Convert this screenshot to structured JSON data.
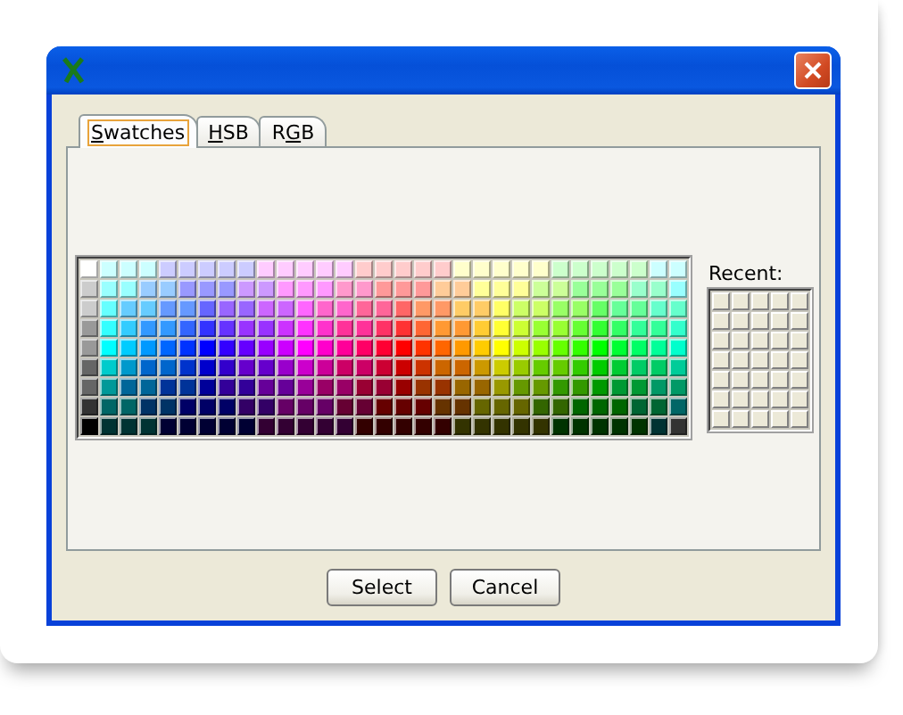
{
  "tabs": [
    {
      "mnemonic": "S",
      "label_after": "watches",
      "selected": true
    },
    {
      "mnemonic": "H",
      "label_after": "SB",
      "selected": false
    },
    {
      "label_before": "R",
      "mnemonic": "G",
      "label_after": "B",
      "selected": false
    }
  ],
  "swatches": [
    [
      {
        "color": "#ffffff"
      },
      {
        "color": "#ccffff"
      },
      {
        "color": "#ccffff"
      },
      {
        "color": "#ccffff"
      },
      {
        "color": "#ccccff"
      },
      {
        "color": "#ccccff"
      },
      {
        "color": "#ccccff"
      },
      {
        "color": "#ccccff"
      },
      {
        "color": "#ccccff"
      },
      {
        "color": "#ffccff"
      },
      {
        "color": "#ffccff"
      },
      {
        "color": "#ffccff"
      },
      {
        "color": "#ffccff"
      },
      {
        "color": "#ffccff"
      },
      {
        "color": "#ffcccc"
      },
      {
        "color": "#ffcccc"
      },
      {
        "color": "#ffcccc"
      },
      {
        "color": "#ffcccc"
      },
      {
        "color": "#ffcccc"
      },
      {
        "color": "#ffffcc"
      },
      {
        "color": "#ffffcc"
      },
      {
        "color": "#ffffcc"
      },
      {
        "color": "#ffffcc"
      },
      {
        "color": "#ffffcc"
      },
      {
        "color": "#ccffcc"
      },
      {
        "color": "#ccffcc"
      },
      {
        "color": "#ccffcc"
      },
      {
        "color": "#ccffcc"
      },
      {
        "color": "#ccffcc"
      },
      {
        "color": "#ccffff"
      },
      {
        "color": "#ccffff"
      }
    ],
    [
      {
        "color": "#cccccc"
      },
      {
        "color": "#99ffff"
      },
      {
        "color": "#99ffff"
      },
      {
        "color": "#99ccff"
      },
      {
        "color": "#99ccff"
      },
      {
        "color": "#9999ff"
      },
      {
        "color": "#9999ff"
      },
      {
        "color": "#9999ff"
      },
      {
        "color": "#cc99ff"
      },
      {
        "color": "#cc99ff"
      },
      {
        "color": "#ff99ff"
      },
      {
        "color": "#ff99ff"
      },
      {
        "color": "#ff99ff"
      },
      {
        "color": "#ff99cc"
      },
      {
        "color": "#ff99cc"
      },
      {
        "color": "#ff9999"
      },
      {
        "color": "#ff9999"
      },
      {
        "color": "#ff9999"
      },
      {
        "color": "#ffcc99"
      },
      {
        "color": "#ffcc99"
      },
      {
        "color": "#ffff99"
      },
      {
        "color": "#ffff99"
      },
      {
        "color": "#ffff99"
      },
      {
        "color": "#ccff99"
      },
      {
        "color": "#ccff99"
      },
      {
        "color": "#99ff99"
      },
      {
        "color": "#99ff99"
      },
      {
        "color": "#99ff99"
      },
      {
        "color": "#99ffcc"
      },
      {
        "color": "#99ffcc"
      },
      {
        "color": "#99ffff"
      }
    ],
    [
      {
        "color": "#cccccc"
      },
      {
        "color": "#66ffff"
      },
      {
        "color": "#66ccff"
      },
      {
        "color": "#66ccff"
      },
      {
        "color": "#6699ff"
      },
      {
        "color": "#6699ff"
      },
      {
        "color": "#6666ff"
      },
      {
        "color": "#9966ff"
      },
      {
        "color": "#9966ff"
      },
      {
        "color": "#cc66ff"
      },
      {
        "color": "#cc66ff"
      },
      {
        "color": "#ff66ff"
      },
      {
        "color": "#ff66cc"
      },
      {
        "color": "#ff66cc"
      },
      {
        "color": "#ff6699"
      },
      {
        "color": "#ff6699"
      },
      {
        "color": "#ff6666"
      },
      {
        "color": "#ff9966"
      },
      {
        "color": "#ff9966"
      },
      {
        "color": "#ffcc66"
      },
      {
        "color": "#ffcc66"
      },
      {
        "color": "#ffff66"
      },
      {
        "color": "#ccff66"
      },
      {
        "color": "#ccff66"
      },
      {
        "color": "#99ff66"
      },
      {
        "color": "#99ff66"
      },
      {
        "color": "#66ff66"
      },
      {
        "color": "#66ff99"
      },
      {
        "color": "#66ff99"
      },
      {
        "color": "#66ffcc"
      },
      {
        "color": "#66ffcc"
      }
    ],
    [
      {
        "color": "#999999"
      },
      {
        "color": "#33ffff"
      },
      {
        "color": "#33ccff"
      },
      {
        "color": "#3399ff"
      },
      {
        "color": "#3399ff"
      },
      {
        "color": "#3366ff"
      },
      {
        "color": "#3333ff"
      },
      {
        "color": "#6633ff"
      },
      {
        "color": "#9933ff"
      },
      {
        "color": "#9933ff"
      },
      {
        "color": "#cc33ff"
      },
      {
        "color": "#ff33ff"
      },
      {
        "color": "#ff33cc"
      },
      {
        "color": "#ff3399"
      },
      {
        "color": "#ff3399"
      },
      {
        "color": "#ff3366"
      },
      {
        "color": "#ff3333"
      },
      {
        "color": "#ff6633"
      },
      {
        "color": "#ff9933"
      },
      {
        "color": "#ff9933"
      },
      {
        "color": "#ffcc33"
      },
      {
        "color": "#ffff33"
      },
      {
        "color": "#ccff33"
      },
      {
        "color": "#99ff33"
      },
      {
        "color": "#99ff33"
      },
      {
        "color": "#66ff33"
      },
      {
        "color": "#33ff33"
      },
      {
        "color": "#33ff66"
      },
      {
        "color": "#33ff99"
      },
      {
        "color": "#33ff99"
      },
      {
        "color": "#33ffcc"
      }
    ],
    [
      {
        "color": "#999999"
      },
      {
        "color": "#00ffff"
      },
      {
        "color": "#00ccff"
      },
      {
        "color": "#0099ff"
      },
      {
        "color": "#0066ff"
      },
      {
        "color": "#0033ff"
      },
      {
        "color": "#0000ff"
      },
      {
        "color": "#3300ff"
      },
      {
        "color": "#6600ff"
      },
      {
        "color": "#9900ff"
      },
      {
        "color": "#cc00ff"
      },
      {
        "color": "#ff00ff"
      },
      {
        "color": "#ff00cc"
      },
      {
        "color": "#ff0099"
      },
      {
        "color": "#ff0066"
      },
      {
        "color": "#ff0033"
      },
      {
        "color": "#ff0000"
      },
      {
        "color": "#ff3300"
      },
      {
        "color": "#ff6600"
      },
      {
        "color": "#ff9900"
      },
      {
        "color": "#ffcc00"
      },
      {
        "color": "#ffff00"
      },
      {
        "color": "#ccff00"
      },
      {
        "color": "#99ff00"
      },
      {
        "color": "#66ff00"
      },
      {
        "color": "#33ff00"
      },
      {
        "color": "#00ff00"
      },
      {
        "color": "#00ff33"
      },
      {
        "color": "#00ff66"
      },
      {
        "color": "#00ff99"
      },
      {
        "color": "#00ffcc"
      }
    ],
    [
      {
        "color": "#666666"
      },
      {
        "color": "#00cccc"
      },
      {
        "color": "#0099cc"
      },
      {
        "color": "#0066cc"
      },
      {
        "color": "#0066cc"
      },
      {
        "color": "#0033cc"
      },
      {
        "color": "#0000cc"
      },
      {
        "color": "#3300cc"
      },
      {
        "color": "#6600cc"
      },
      {
        "color": "#6600cc"
      },
      {
        "color": "#9900cc"
      },
      {
        "color": "#cc00cc"
      },
      {
        "color": "#cc0099"
      },
      {
        "color": "#cc0066"
      },
      {
        "color": "#cc0066"
      },
      {
        "color": "#cc0033"
      },
      {
        "color": "#cc0000"
      },
      {
        "color": "#cc3300"
      },
      {
        "color": "#cc6600"
      },
      {
        "color": "#cc6600"
      },
      {
        "color": "#cc9900"
      },
      {
        "color": "#cccc00"
      },
      {
        "color": "#99cc00"
      },
      {
        "color": "#66cc00"
      },
      {
        "color": "#66cc00"
      },
      {
        "color": "#33cc00"
      },
      {
        "color": "#00cc00"
      },
      {
        "color": "#00cc33"
      },
      {
        "color": "#00cc66"
      },
      {
        "color": "#00cc66"
      },
      {
        "color": "#00cc99"
      }
    ],
    [
      {
        "color": "#666666"
      },
      {
        "color": "#009999"
      },
      {
        "color": "#006699"
      },
      {
        "color": "#006699"
      },
      {
        "color": "#003399"
      },
      {
        "color": "#003399"
      },
      {
        "color": "#000099"
      },
      {
        "color": "#330099"
      },
      {
        "color": "#330099"
      },
      {
        "color": "#660099"
      },
      {
        "color": "#660099"
      },
      {
        "color": "#990099"
      },
      {
        "color": "#990066"
      },
      {
        "color": "#990066"
      },
      {
        "color": "#990033"
      },
      {
        "color": "#990033"
      },
      {
        "color": "#990000"
      },
      {
        "color": "#993300"
      },
      {
        "color": "#993300"
      },
      {
        "color": "#996600"
      },
      {
        "color": "#996600"
      },
      {
        "color": "#999900"
      },
      {
        "color": "#669900"
      },
      {
        "color": "#669900"
      },
      {
        "color": "#339900"
      },
      {
        "color": "#339900"
      },
      {
        "color": "#009900"
      },
      {
        "color": "#009933"
      },
      {
        "color": "#009933"
      },
      {
        "color": "#009966"
      },
      {
        "color": "#009966"
      }
    ],
    [
      {
        "color": "#333333"
      },
      {
        "color": "#006666"
      },
      {
        "color": "#006666"
      },
      {
        "color": "#003366"
      },
      {
        "color": "#003366"
      },
      {
        "color": "#000066"
      },
      {
        "color": "#000066"
      },
      {
        "color": "#000066"
      },
      {
        "color": "#330066"
      },
      {
        "color": "#330066"
      },
      {
        "color": "#660066"
      },
      {
        "color": "#660066"
      },
      {
        "color": "#660066"
      },
      {
        "color": "#660033"
      },
      {
        "color": "#660033"
      },
      {
        "color": "#660000"
      },
      {
        "color": "#660000"
      },
      {
        "color": "#660000"
      },
      {
        "color": "#663300"
      },
      {
        "color": "#663300"
      },
      {
        "color": "#666600"
      },
      {
        "color": "#666600"
      },
      {
        "color": "#666600"
      },
      {
        "color": "#336600"
      },
      {
        "color": "#336600"
      },
      {
        "color": "#006600"
      },
      {
        "color": "#006600"
      },
      {
        "color": "#006600"
      },
      {
        "color": "#006633"
      },
      {
        "color": "#006633"
      },
      {
        "color": "#006666"
      }
    ],
    [
      {
        "color": "#000000"
      },
      {
        "color": "#003333"
      },
      {
        "color": "#003333"
      },
      {
        "color": "#003333"
      },
      {
        "color": "#000033"
      },
      {
        "color": "#000033"
      },
      {
        "color": "#000033"
      },
      {
        "color": "#000033"
      },
      {
        "color": "#000033"
      },
      {
        "color": "#330033"
      },
      {
        "color": "#330033"
      },
      {
        "color": "#330033"
      },
      {
        "color": "#330033"
      },
      {
        "color": "#330033"
      },
      {
        "color": "#330000"
      },
      {
        "color": "#330000"
      },
      {
        "color": "#330000"
      },
      {
        "color": "#330000"
      },
      {
        "color": "#330000"
      },
      {
        "color": "#333300"
      },
      {
        "color": "#333300"
      },
      {
        "color": "#333300"
      },
      {
        "color": "#333300"
      },
      {
        "color": "#333300"
      },
      {
        "color": "#003300"
      },
      {
        "color": "#003300"
      },
      {
        "color": "#003300"
      },
      {
        "color": "#003300"
      },
      {
        "color": "#003300"
      },
      {
        "color": "#003333"
      },
      {
        "color": "#333333"
      }
    ]
  ],
  "recent": {
    "label": "Recent:"
  },
  "buttons": [
    "Select",
    "Cancel"
  ]
}
